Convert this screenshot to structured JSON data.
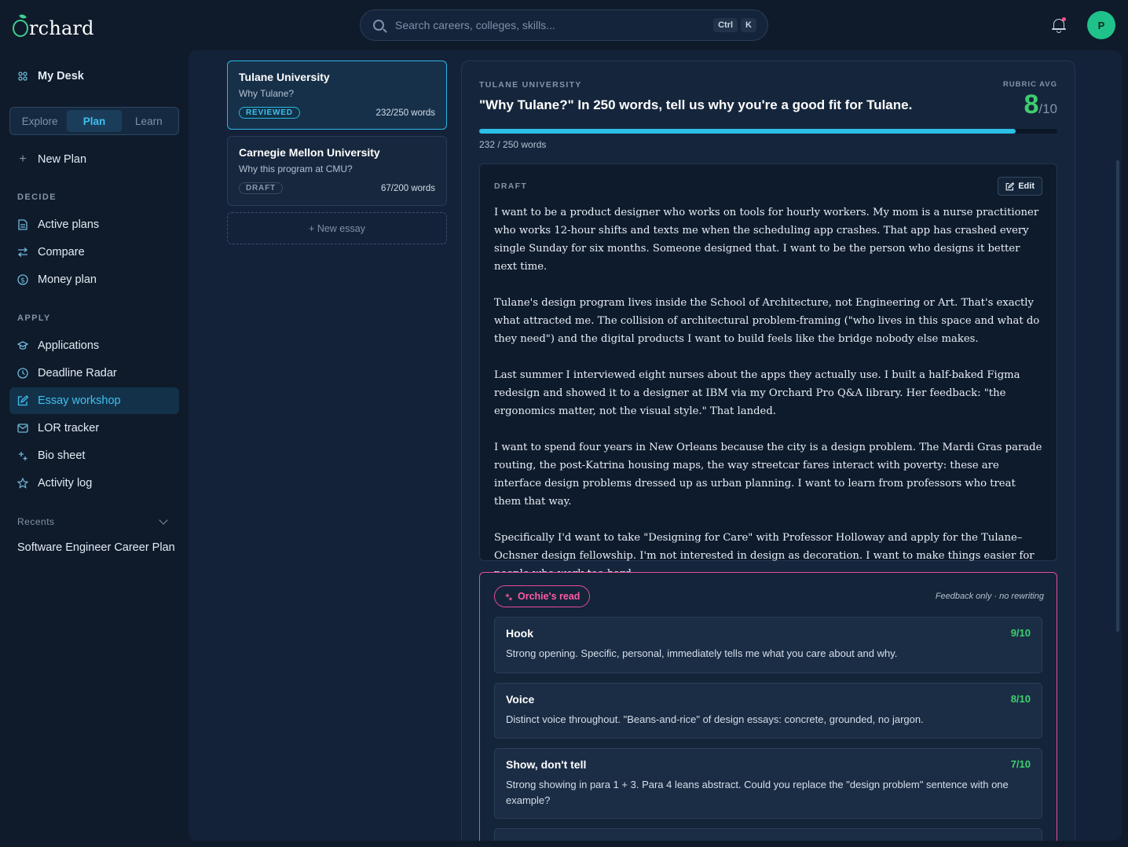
{
  "app": {
    "logo_rest": "rchard"
  },
  "search": {
    "placeholder": "Search careers, colleges, skills...",
    "key1": "Ctrl",
    "key2": "K"
  },
  "user": {
    "initial": "P"
  },
  "sidebar": {
    "my_desk": "My Desk",
    "tabs": [
      "Explore",
      "Plan",
      "Learn"
    ],
    "new_plan": "New Plan",
    "decide_label": "DECIDE",
    "decide_items": [
      "Active plans",
      "Compare",
      "Money plan"
    ],
    "apply_label": "APPLY",
    "apply_items": [
      "Applications",
      "Deadline Radar",
      "Essay workshop",
      "LOR tracker",
      "Bio sheet",
      "Activity log"
    ],
    "recents_label": "Recents",
    "recents": [
      "Software Engineer Career Plan"
    ]
  },
  "essays": [
    {
      "school": "Tulane University",
      "prompt": "Why Tulane?",
      "status": "REVIEWED",
      "words": "232/250 words"
    },
    {
      "school": "Carnegie Mellon University",
      "prompt": "Why this program at CMU?",
      "status": "DRAFT",
      "words": "67/200 words"
    }
  ],
  "new_essay": "+ New essay",
  "detail": {
    "school": "TULANE UNIVERSITY",
    "prompt": "\"Why Tulane?\" In 250 words, tell us why you're a good fit for Tulane.",
    "rubric_label": "RUBRIC AVG",
    "rubric_score": "8",
    "rubric_den": "/10",
    "progress": 0.928,
    "word_count": "232 / 250 words",
    "draft_label": "DRAFT",
    "edit_label": "Edit",
    "paragraphs": [
      "I want to be a product designer who works on tools for hourly workers. My mom is a nurse practitioner who works 12-hour shifts and texts me when the scheduling app crashes. That app has crashed every single Sunday for six months. Someone designed that. I want to be the person who designs it better next time.",
      "Tulane's design program lives inside the School of Architecture, not Engineering or Art. That's exactly what attracted me. The collision of architectural problem-framing (\"who lives in this space and what do they need\") and the digital products I want to build feels like the bridge nobody else makes.",
      "Last summer I interviewed eight nurses about the apps they actually use. I built a half-baked Figma redesign and showed it to a designer at IBM via my Orchard Pro Q&A library. Her feedback: \"the ergonomics matter, not the visual style.\" That landed.",
      "I want to spend four years in New Orleans because the city is a design problem. The Mardi Gras parade routing, the post-Katrina housing maps, the way streetcar fares interact with poverty: these are interface design problems dressed up as urban planning. I want to learn from professors who treat them that way.",
      "Specifically I'd want to take \"Designing for Care\" with Professor Holloway and apply for the Tulane–Ochsner design fellowship. I'm not interested in design as decoration. I want to make things easier for people who work too hard."
    ],
    "orchie_label": "Orchie's read",
    "orchie_note": "Feedback only · no rewriting",
    "criteria": [
      {
        "name": "Hook",
        "score": "9/10",
        "text": "Strong opening. Specific, personal, immediately tells me what you care about and why."
      },
      {
        "name": "Voice",
        "score": "8/10",
        "text": "Distinct voice throughout. \"Beans-and-rice\" of design essays: concrete, grounded, no jargon."
      },
      {
        "name": "Show, don't tell",
        "score": "7/10",
        "text": "Strong showing in para 1 + 3. Para 4 leans abstract. Could you replace the \"design problem\" sentence with one example?"
      }
    ]
  },
  "colors": {
    "accent": "#2bc0e8",
    "score_green": "#3ecf6e",
    "orchie_pink": "#e64b9a",
    "avatar": "#1fc28a"
  }
}
